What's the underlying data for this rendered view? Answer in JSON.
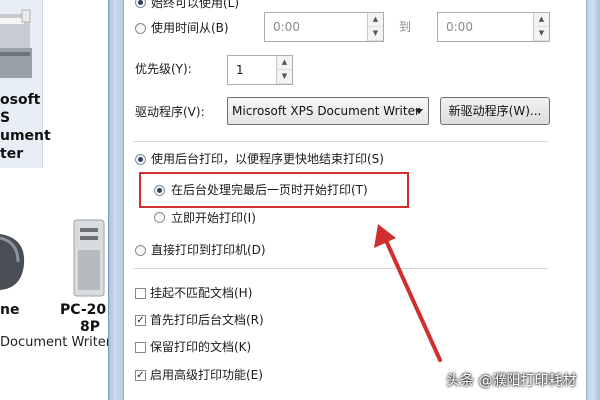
{
  "background": {
    "device_label_lines": [
      "osoft",
      "S",
      "ument",
      "ter"
    ],
    "bottom_label": "Document Writer",
    "pc_label_line1": "PC-20",
    "pc_label_line2": "8P",
    "me_label": "ne"
  },
  "dialog": {
    "always_available": {
      "label": "始终可以使用(L)"
    },
    "available_from": {
      "label": "使用时间从(B)",
      "from_time": "0:00",
      "to_label": "到",
      "to_time": "0:00"
    },
    "priority": {
      "label": "优先级(Y):",
      "value": "1"
    },
    "driver": {
      "label": "驱动程序(V):",
      "selected": "Microsoft XPS Document Writer",
      "new_driver_button": "新驱动程序(W)..."
    },
    "spool": {
      "label": "使用后台打印，以便程序更快地结束打印(S)",
      "after_last_page": "在后台处理完最后一页时开始打印(T)",
      "immediately": "立即开始打印(I)"
    },
    "direct_print": {
      "label": "直接打印到打印机(D)"
    },
    "options": [
      {
        "label": "挂起不匹配文档(H)",
        "checked": false
      },
      {
        "label": "首先打印后台文档(R)",
        "checked": true
      },
      {
        "label": "保留打印的文档(K)",
        "checked": false
      },
      {
        "label": "启用高级打印功能(E)",
        "checked": true
      }
    ]
  },
  "annotation": {
    "highlight_color": "#d12e2e",
    "arrow_color": "#d12e2e"
  },
  "watermark": "头条 @濮阳打印耗材"
}
